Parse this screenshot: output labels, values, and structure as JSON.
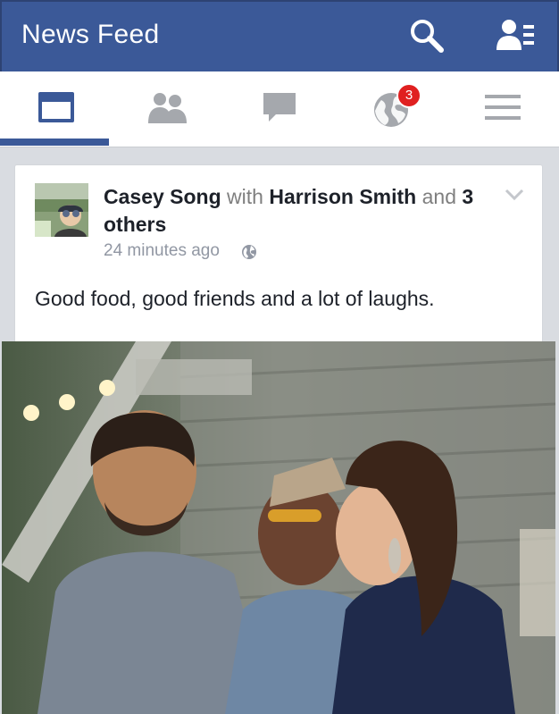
{
  "header": {
    "title": "News Feed",
    "search_icon": "search-icon",
    "friends_icon": "friend-requests-icon"
  },
  "tabs": [
    {
      "name": "news-feed",
      "icon": "news-feed-icon",
      "active": true
    },
    {
      "name": "friends",
      "icon": "friends-icon",
      "active": false
    },
    {
      "name": "messages",
      "icon": "messages-icon",
      "active": false
    },
    {
      "name": "notifications",
      "icon": "globe-icon",
      "active": false,
      "badge": "3"
    },
    {
      "name": "more",
      "icon": "menu-icon",
      "active": false
    }
  ],
  "post": {
    "author": "Casey Song",
    "with_word": "with",
    "tagged": "Harrison Smith",
    "and_word": "and",
    "others": "3 others",
    "time": "24 minutes ago",
    "privacy_icon": "globe-icon",
    "text": "Good food, good friends and a lot of laughs."
  },
  "colors": {
    "brand": "#3b5998",
    "badge": "#e02020",
    "background": "#d9dce1"
  }
}
